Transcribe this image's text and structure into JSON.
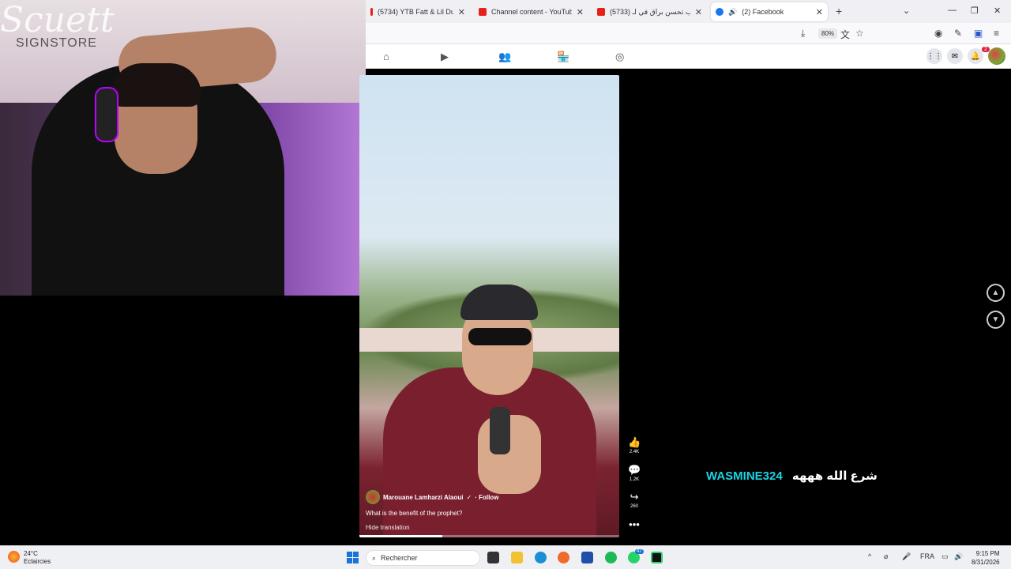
{
  "webcam": {
    "sign_text": "Scuett",
    "sign_sub": "SIGNSTORE"
  },
  "browser": {
    "tabs": [
      {
        "title": "(5734) YTB Fatt & Lil Durk - Cor",
        "color": "#e62117"
      },
      {
        "title": "Channel content - YouTube Stu",
        "color": "#e62117"
      },
      {
        "title": "(5733) صواب تحسن براق في لـ",
        "color": "#e62117"
      },
      {
        "title": "(2) Facebook",
        "color": "#1877f2",
        "active": true
      }
    ],
    "zoom": "80%"
  },
  "facebook": {
    "notification_count": "2",
    "reel": {
      "author": "Marouane Lamharzi Alaoui",
      "follow_label": "· Follow",
      "description": "What is the benefit of the prophet?",
      "hide_translation": "Hide translation",
      "progress": 0.32,
      "likes": "2.4K",
      "comments": "1.2K",
      "shares": "260"
    }
  },
  "stream_overlay": {
    "name": "WASMINE324",
    "arabic": "شرع الله هههه"
  },
  "taskbar": {
    "temperature": "24°C",
    "weather": "Eclaircies",
    "search_placeholder": "Rechercher",
    "whatsapp_badge": "47",
    "language": "FRA",
    "time": "9:15 PM",
    "date": "8/31/2026"
  }
}
